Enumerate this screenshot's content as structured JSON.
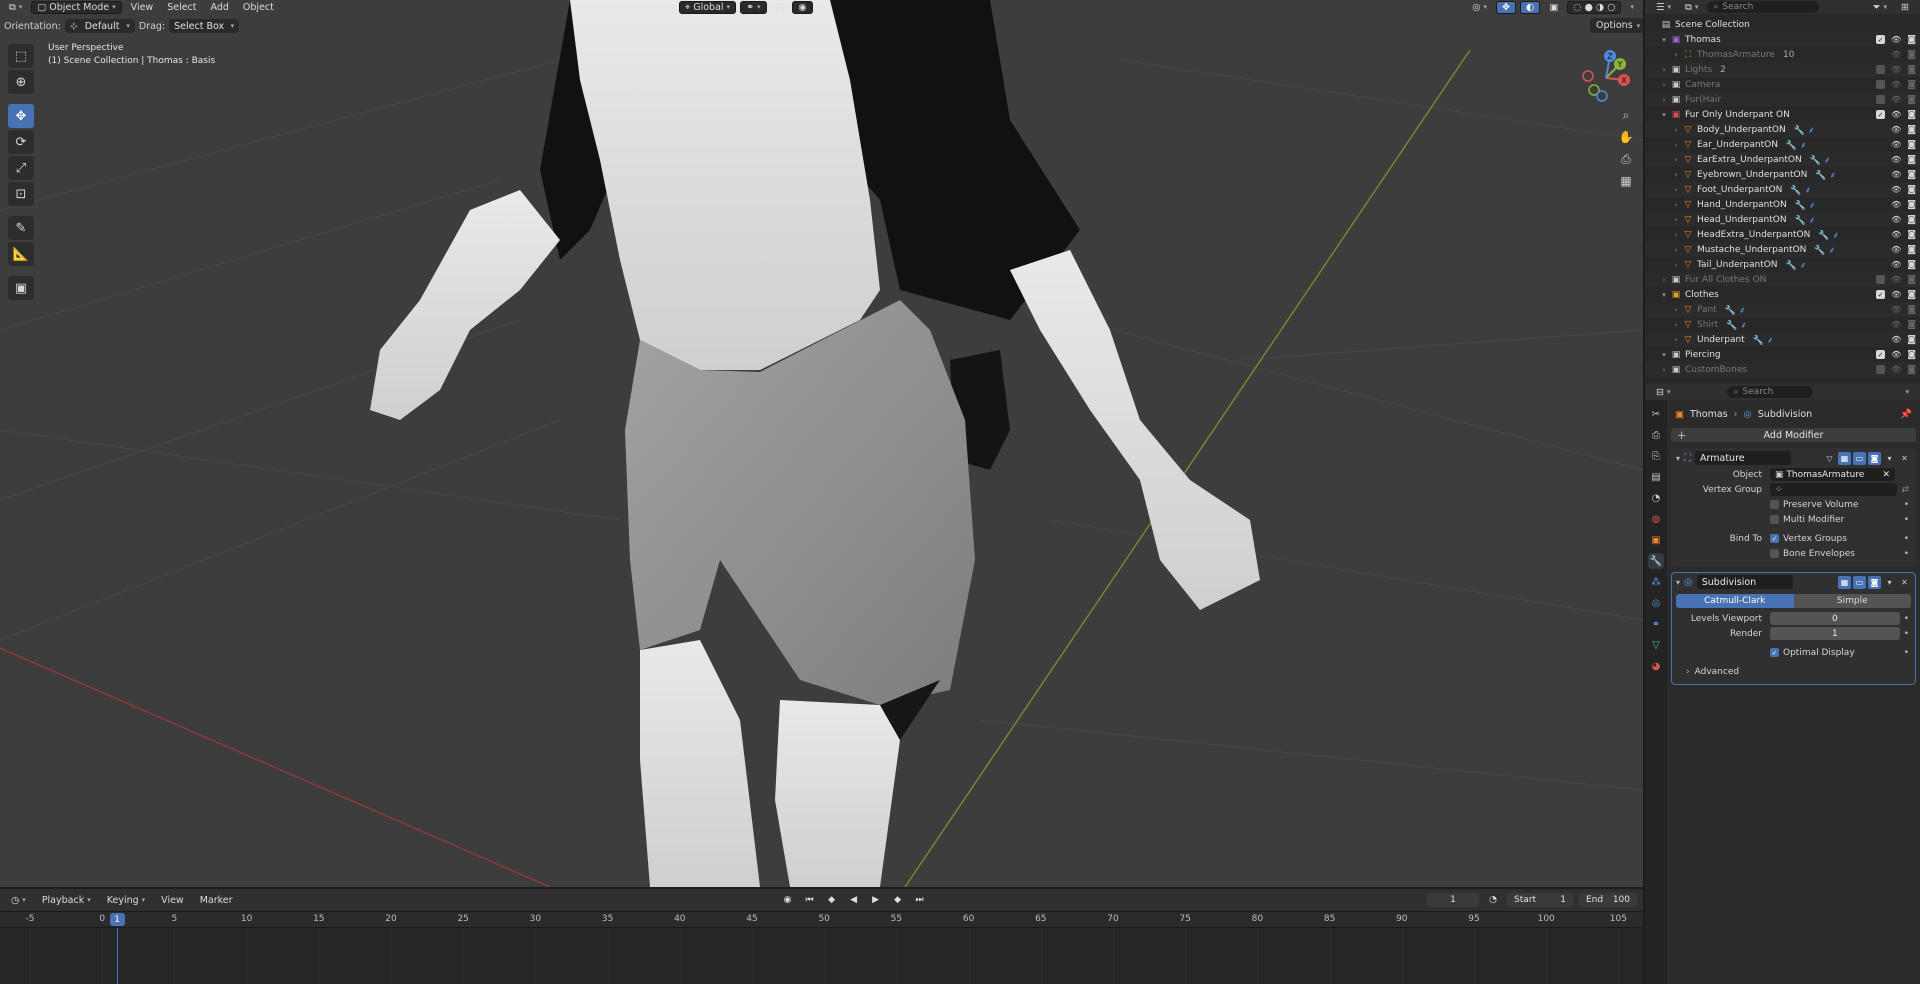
{
  "viewport": {
    "header": {
      "editor_icon": "viewport-editor-icon",
      "mode": "Object Mode",
      "menus": [
        "View",
        "Select",
        "Add",
        "Object"
      ],
      "transform": "Global",
      "search_placeholder": "Search"
    },
    "header2": {
      "orientation_label": "Orientation:",
      "orientation_value": "Default",
      "drag_label": "Drag:",
      "drag_value": "Select Box",
      "options": "Options"
    },
    "info": {
      "perspective": "User Perspective",
      "collection": "(1) Scene Collection | Thomas : Basis"
    },
    "gizmo": {
      "x": "X",
      "y": "Y",
      "z": "Z"
    }
  },
  "timeline": {
    "menus": [
      "Playback",
      "Keying",
      "View",
      "Marker"
    ],
    "current_frame": "1",
    "start_label": "Start",
    "start_value": "1",
    "end_label": "End",
    "end_value": "100",
    "ticks": [
      "-5",
      "0",
      "5",
      "10",
      "15",
      "20",
      "25",
      "30",
      "35",
      "40",
      "45",
      "50",
      "55",
      "60",
      "65",
      "70",
      "75",
      "80",
      "85",
      "90",
      "95",
      "100",
      "105"
    ],
    "playhead": "1"
  },
  "outliner": {
    "search_placeholder": "Search",
    "rows": [
      {
        "label": "Scene Collection",
        "kind": "scene"
      },
      {
        "label": "Thomas",
        "kind": "collection",
        "color": "#9b6bd6"
      },
      {
        "label": "ThomasArmature",
        "kind": "armature",
        "dim": true,
        "badge": "10"
      },
      {
        "label": "Lights",
        "kind": "collection",
        "dim": true,
        "badge": "2"
      },
      {
        "label": "Camera",
        "kind": "collection",
        "dim": true
      },
      {
        "label": "Fur(Hair",
        "kind": "collection",
        "dim": true
      },
      {
        "label": "Fur Only Underpant ON",
        "kind": "collection",
        "color": "#d9534f"
      },
      {
        "label": "Body_UnderpantON",
        "kind": "object"
      },
      {
        "label": "Ear_UnderpantON",
        "kind": "object"
      },
      {
        "label": "EarExtra_UnderpantON",
        "kind": "object"
      },
      {
        "label": "Eyebrown_UnderpantON",
        "kind": "object"
      },
      {
        "label": "Foot_UnderpantON",
        "kind": "object"
      },
      {
        "label": "Hand_UnderpantON",
        "kind": "object"
      },
      {
        "label": "Head_UnderpantON",
        "kind": "object"
      },
      {
        "label": "HeadExtra_UnderpantON",
        "kind": "object"
      },
      {
        "label": "Mustache_UnderpantON",
        "kind": "object"
      },
      {
        "label": "Tail_UnderpantON",
        "kind": "object"
      },
      {
        "label": "Fur All Clothes ON",
        "kind": "collection",
        "dim": true
      },
      {
        "label": "Clothes",
        "kind": "collection",
        "color": "#e0a020"
      },
      {
        "label": "Pant",
        "kind": "object",
        "dim": true
      },
      {
        "label": "Shirt",
        "kind": "object",
        "dim": true
      },
      {
        "label": "Underpant",
        "kind": "object"
      },
      {
        "label": "Piercing",
        "kind": "collection"
      },
      {
        "label": "CustomBones",
        "kind": "collection",
        "dim": true
      }
    ]
  },
  "properties": {
    "search_placeholder": "Search",
    "breadcrumb_object": "Thomas",
    "breadcrumb_modifier": "Subdivision",
    "add_modifier": "Add Modifier",
    "armature": {
      "name": "Armature",
      "object_label": "Object",
      "object_value": "ThomasArmature",
      "vertex_group_label": "Vertex Group",
      "preserve_volume": "Preserve Volume",
      "multi_modifier": "Multi Modifier",
      "bind_to_label": "Bind To",
      "vertex_groups": "Vertex Groups",
      "bone_envelopes": "Bone Envelopes"
    },
    "subdivision": {
      "name": "Subdivision",
      "catmull": "Catmull-Clark",
      "simple": "Simple",
      "levels_label": "Levels Viewport",
      "levels_value": "0",
      "render_label": "Render",
      "render_value": "1",
      "optimal": "Optimal Display",
      "advanced": "Advanced"
    }
  }
}
